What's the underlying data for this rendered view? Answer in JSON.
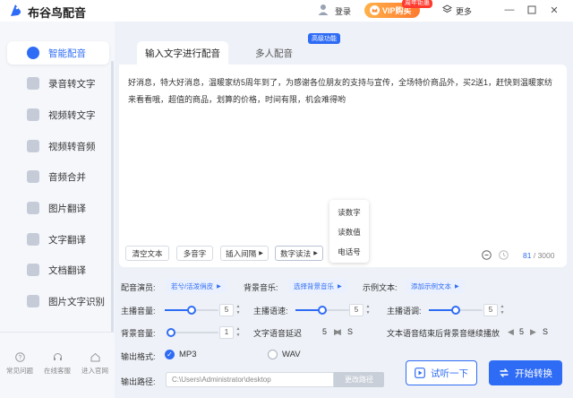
{
  "app": {
    "title": "布谷鸟配音",
    "brand_color": "#2f6cf5"
  },
  "header": {
    "login": "登录",
    "vip": "VIP购买",
    "vip_badge": "周年钜惠",
    "more": "更多",
    "window_controls": [
      "minimize-icon",
      "restore-icon",
      "close-icon"
    ]
  },
  "sidebar": {
    "items": [
      {
        "label": "智能配音",
        "icon": "microphone-icon",
        "active": true
      },
      {
        "label": "录音转文字",
        "icon": "audio-text-icon"
      },
      {
        "label": "视频转文字",
        "icon": "video-text-icon"
      },
      {
        "label": "视频转音频",
        "icon": "video-audio-icon"
      },
      {
        "label": "音频合并",
        "icon": "merge-icon"
      },
      {
        "label": "图片翻译",
        "icon": "image-translate-icon"
      },
      {
        "label": "文字翻译",
        "icon": "text-translate-icon"
      },
      {
        "label": "文档翻译",
        "icon": "doc-translate-icon"
      },
      {
        "label": "图片文字识别",
        "icon": "ocr-icon"
      }
    ],
    "bottom": [
      {
        "label": "常见问题",
        "icon": "help-icon"
      },
      {
        "label": "在线客服",
        "icon": "headset-icon"
      },
      {
        "label": "进入官网",
        "icon": "home-icon"
      }
    ]
  },
  "main": {
    "tabs": [
      {
        "label": "输入文字进行配音",
        "active": true
      },
      {
        "label": "多人配音"
      }
    ],
    "advanced_badge": "高级功能",
    "text": "好消息，特大好消息，温暖家纺5周年到了，为感谢各位朋友的支持与宣传，全场特价商品外，买2送1，赶快到温暖家纺来看看哦，超值的商品，划算的价格，时间有限，机会难得哟",
    "toolbar": [
      "清空文本",
      "多音字",
      "插入间隔",
      "数字读法"
    ],
    "number_menu": [
      "读数字",
      "读数值",
      "电话号"
    ],
    "counter_current": "81",
    "counter_max": "/ 3000"
  },
  "settings": {
    "speaker_label": "配音演员:",
    "speaker_value": "若兮/活泼俏皮",
    "bgm_label": "背景音乐:",
    "bgm_value": "选择背景音乐",
    "sample_label": "示例文本:",
    "sample_value": "添加示例文本",
    "volume_label": "主播音量:",
    "volume_value": "5",
    "volume_level": 0.5,
    "speed_label": "主播语速:",
    "speed_value": "5",
    "speed_level": 0.5,
    "pitch_label": "主播语调:",
    "pitch_value": "5",
    "pitch_level": 0.5,
    "bg_volume_label": "背景音量:",
    "bg_volume_value": "1",
    "bg_volume_level": 0.0,
    "delay_label": "文字语音延迟",
    "delay_value": "5",
    "delay_unit": "S",
    "tail_label": "文本语音结束后背景音继续播放",
    "tail_value": "5",
    "tail_unit": "S",
    "format_label": "输出格式:",
    "format_options": [
      "MP3",
      "WAV"
    ],
    "format_selected": "MP3",
    "path_label": "输出路径:",
    "path_value": "C:\\Users\\Administrator\\desktop",
    "path_button": "更改路径",
    "listen_button": "试听一下",
    "convert_button": "开始转换"
  }
}
